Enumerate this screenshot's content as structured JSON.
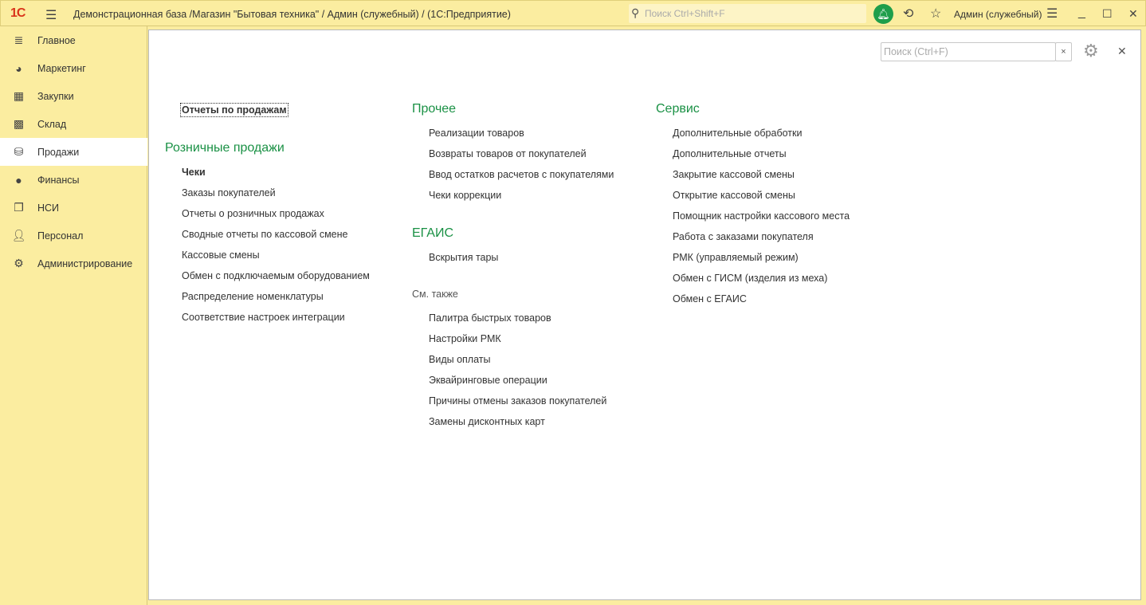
{
  "titlebar": {
    "logo": "1С",
    "title": "Демонстрационная база /Магазин \"Бытовая техника\" / Админ (служебный) /  (1С:Предприятие)",
    "search_placeholder": "Поиск Ctrl+Shift+F",
    "user": "Админ (служебный)"
  },
  "sidebar": {
    "items": [
      {
        "label": "Главное",
        "icon": "menu-icon"
      },
      {
        "label": "Маркетинг",
        "icon": "pie-chart-icon"
      },
      {
        "label": "Закупки",
        "icon": "cart-icon"
      },
      {
        "label": "Склад",
        "icon": "warehouse-icon"
      },
      {
        "label": "Продажи",
        "icon": "basket-icon",
        "active": true
      },
      {
        "label": "Финансы",
        "icon": "ruble-icon"
      },
      {
        "label": "НСИ",
        "icon": "documents-icon"
      },
      {
        "label": "Персонал",
        "icon": "person-icon"
      },
      {
        "label": "Администрирование",
        "icon": "gear-icon"
      }
    ]
  },
  "content": {
    "search_placeholder": "Поиск (Ctrl+F)",
    "col1": {
      "top_link": "Отчеты по продажам",
      "heading": "Розничные продажи",
      "items": [
        "Чеки",
        "Заказы покупателей",
        "Отчеты о розничных продажах",
        "Сводные отчеты по кассовой смене",
        "Кассовые смены",
        "Обмен с подключаемым оборудованием",
        "Распределение номенклатуры",
        "Соответствие настроек интеграции"
      ]
    },
    "col2": {
      "heading": "Прочее",
      "items": [
        "Реализации товаров",
        "Возвраты товаров от покупателей",
        "Ввод остатков расчетов с покупателями",
        "Чеки коррекции"
      ],
      "heading2": "ЕГАИС",
      "items2": [
        "Вскрытия тары"
      ],
      "see_also": "См. также",
      "items3": [
        "Палитра быстрых товаров",
        "Настройки РМК",
        "Виды оплаты",
        "Эквайринговые операции",
        "Причины отмены заказов покупателей",
        "Замены дисконтных карт"
      ]
    },
    "col3": {
      "heading": "Сервис",
      "items": [
        "Дополнительные обработки",
        "Дополнительные отчеты",
        "Закрытие кассовой смены",
        "Открытие кассовой смены",
        "Помощник настройки кассового места",
        "Работа с заказами покупателя",
        "РМК (управляемый режим)",
        "Обмен с ГИСМ (изделия из меха)",
        "Обмен с ЕГАИС"
      ]
    }
  }
}
